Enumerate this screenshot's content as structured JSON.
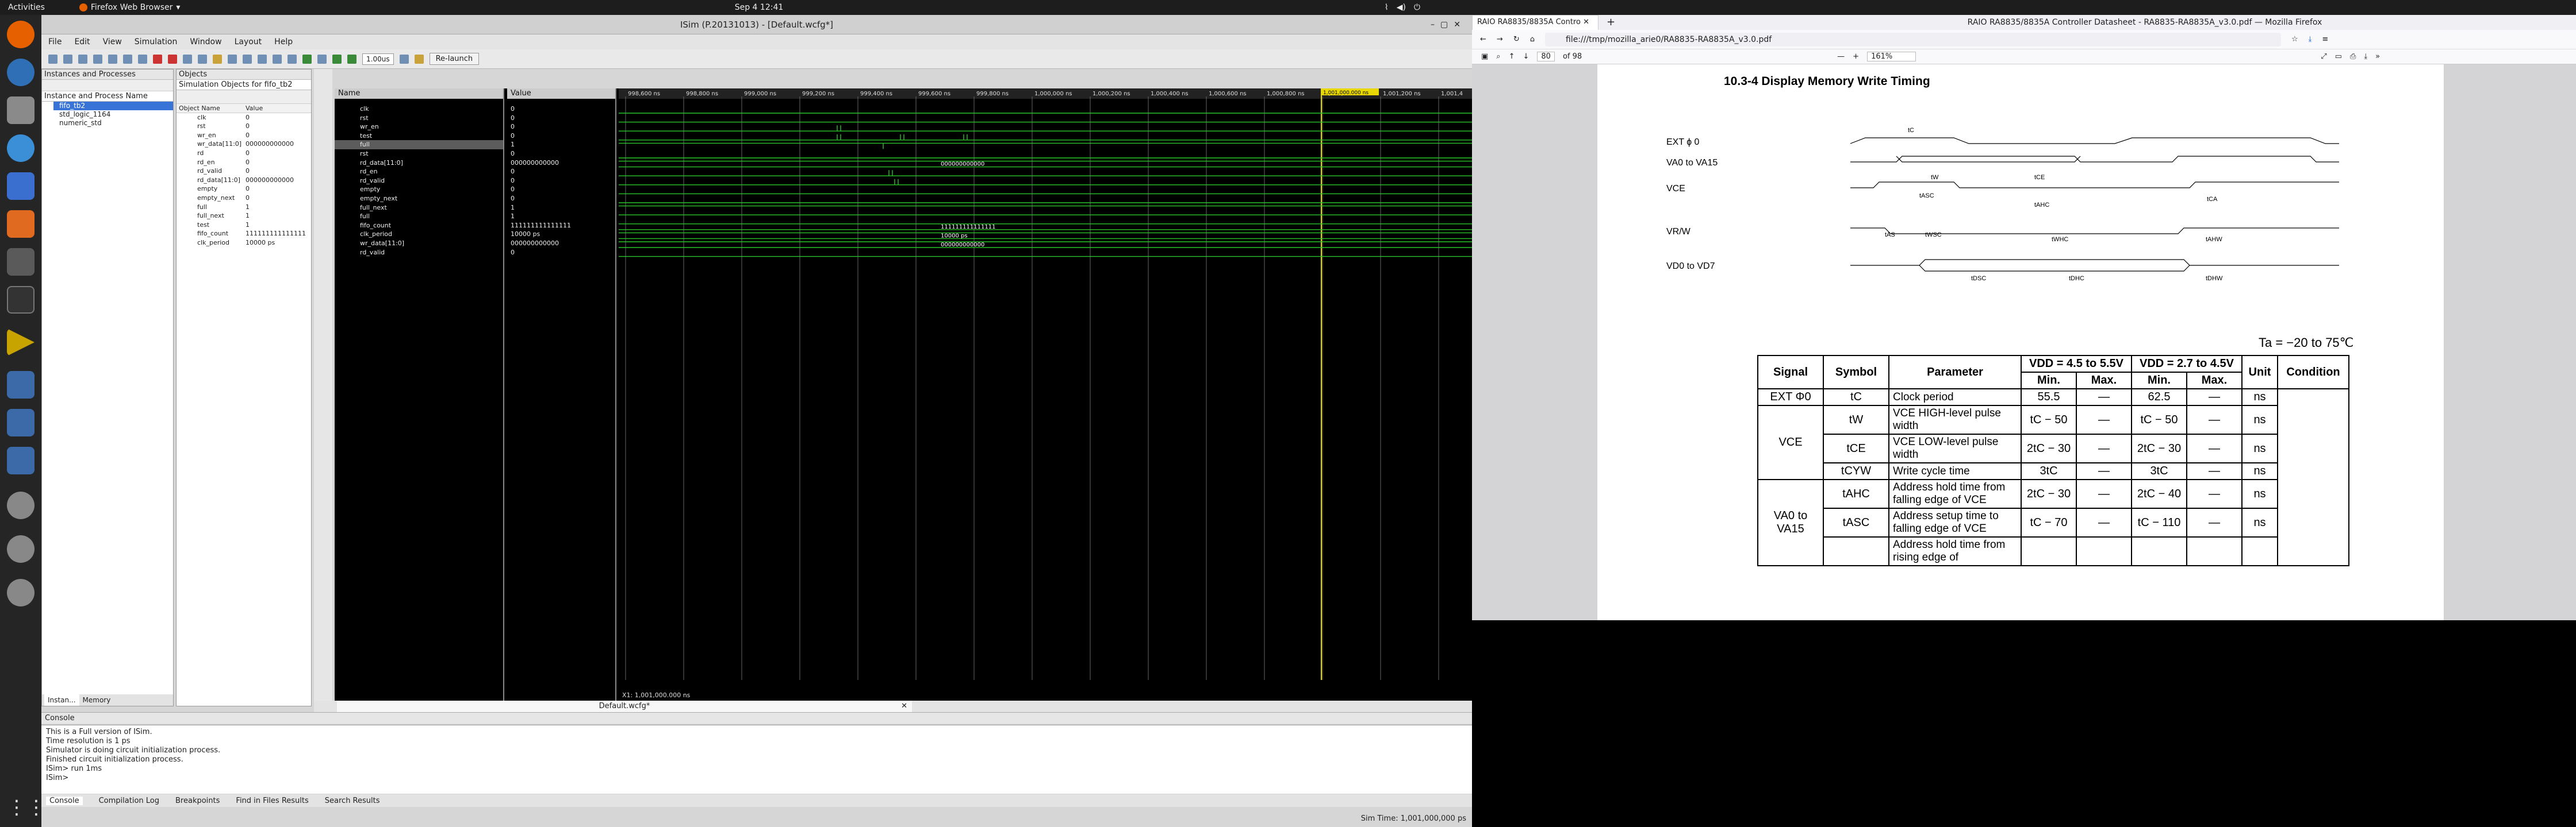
{
  "topbar": {
    "activities": "Activities",
    "app": "Firefox Web Browser",
    "clock": "Sep 4  12:41"
  },
  "isim": {
    "title": "ISim (P.20131013) - [Default.wcfg*]",
    "menus": [
      "File",
      "Edit",
      "View",
      "Simulation",
      "Window",
      "Layout",
      "Help"
    ],
    "time_field": "1.00us",
    "relaunch": "Re-launch",
    "instances_title": "Instances and Processes",
    "instance_col": "Instance and Process Name",
    "instances": [
      "fifo_tb2",
      "std_logic_1164",
      "numeric_std"
    ],
    "objects_title": "Objects",
    "objects_sub": "Simulation Objects for fifo_tb2",
    "objects_cols": {
      "name": "Object Name",
      "value": "Value"
    },
    "objects": [
      {
        "n": "clk",
        "v": "0"
      },
      {
        "n": "rst",
        "v": "0"
      },
      {
        "n": "wr_en",
        "v": "0"
      },
      {
        "n": "wr_data[11:0]",
        "v": "000000000000"
      },
      {
        "n": "rd",
        "v": "0"
      },
      {
        "n": "rd_en",
        "v": "0"
      },
      {
        "n": "rd_valid",
        "v": "0"
      },
      {
        "n": "rd_data[11:0]",
        "v": "000000000000"
      },
      {
        "n": "empty",
        "v": "0"
      },
      {
        "n": "empty_next",
        "v": "0"
      },
      {
        "n": "full",
        "v": "1"
      },
      {
        "n": "full_next",
        "v": "1"
      },
      {
        "n": "test",
        "v": "1"
      },
      {
        "n": "fifo_count",
        "v": "111111111111111"
      },
      {
        "n": "clk_period",
        "v": "10000 ps"
      }
    ],
    "left_tabs": [
      "Instan...",
      "Memory"
    ],
    "wave_cols": {
      "name": "Name",
      "value": "Value"
    },
    "signals": [
      {
        "n": "clk",
        "v": "0"
      },
      {
        "n": "rst",
        "v": "0"
      },
      {
        "n": "wr_en",
        "v": "0"
      },
      {
        "n": "test",
        "v": "0"
      },
      {
        "n": "full",
        "v": "1"
      },
      {
        "n": "rst",
        "v": "0"
      },
      {
        "n": "rd_data[11:0]",
        "v": "000000000000"
      },
      {
        "n": "rd_en",
        "v": "0"
      },
      {
        "n": "rd_valid",
        "v": "0"
      },
      {
        "n": "empty",
        "v": "0"
      },
      {
        "n": "empty_next",
        "v": "0"
      },
      {
        "n": "full_next",
        "v": "1"
      },
      {
        "n": "full",
        "v": "1"
      },
      {
        "n": "fifo_count",
        "v": "111111111111111"
      },
      {
        "n": "clk_period",
        "v": "10000 ps"
      },
      {
        "n": "wr_data[11:0]",
        "v": "000000000000"
      },
      {
        "n": "rd_valid",
        "v": "0"
      }
    ],
    "time_labels": [
      "998,600 ns",
      "998,800 ns",
      "999,000 ns",
      "999,200 ns",
      "999,400 ns",
      "999,600 ns",
      "999,800 ns",
      "1,000,000 ns",
      "1,000,200 ns",
      "1,000,400 ns",
      "1,000,600 ns",
      "1,000,800 ns",
      "1,001,000 ns",
      "1,001,200 ns",
      "1,001,4"
    ],
    "marker_label": "1,001,000.000 ns",
    "cursor_readout": "X1: 1,001,000.000 ns",
    "bus_labels": {
      "rd_data": "000000000000",
      "fifo_count": "111111111111111",
      "clk_period": "10000 ps",
      "wr_data": "000000000000"
    },
    "wave_tab": "Default.wcfg*",
    "console_title": "Console",
    "console_lines": [
      "This is a Full version of ISim.",
      "Time resolution is 1 ps",
      "Simulator is doing circuit initialization process.",
      "Finished circuit initialization process.",
      "ISim> run 1ms",
      "ISim>"
    ],
    "console_tabs": [
      "Console",
      "Compilation Log",
      "Breakpoints",
      "Find in Files Results",
      "Search Results"
    ],
    "sim_time": "Sim Time: 1,001,000,000 ps"
  },
  "firefox": {
    "tab_label": "RAIO RA8835/8835A Contro",
    "window_title": "RAIO RA8835/8835A Controller Datasheet - RA8835-RA8835A_v3.0.pdf — Mozilla Firefox",
    "url": "file:///tmp/mozilla_arie0/RA8835-RA8835A_v3.0.pdf",
    "page_field": "80",
    "page_count": "of 98",
    "zoom": "161%",
    "section_title": "10.3-4 Display Memory Write Timing",
    "timing_signals": [
      "EXT ɸ 0",
      "VA0 to VA15",
      "VCE",
      "VR/W",
      "VD0 to VD7"
    ],
    "timing_labels": [
      "tC",
      "tW",
      "tCE",
      "tASC",
      "tAHC",
      "tCA",
      "tAS",
      "tWSC",
      "tWHC",
      "tAHW",
      "tDSC",
      "tDHC",
      "tDHW"
    ],
    "condition_note": "Ta = −20 to 75℃",
    "table_header": {
      "signal": "Signal",
      "symbol": "Symbol",
      "parameter": "Parameter",
      "vdd1": "VDD = 4.5 to 5.5V",
      "vdd2": "VDD = 2.7 to 4.5V",
      "min": "Min.",
      "max": "Max.",
      "unit": "Unit",
      "condition": "Condition"
    },
    "table_rows": [
      {
        "signal": "EXT Φ0",
        "symbol": "tC",
        "param": "Clock period",
        "min1": "55.5",
        "max1": "—",
        "min2": "62.5",
        "max2": "—",
        "unit": "ns"
      },
      {
        "signal": "VCE",
        "symbol": "tW",
        "param": "VCE  HIGH-level pulse width",
        "min1": "tC − 50",
        "max1": "—",
        "min2": "tC − 50",
        "max2": "—",
        "unit": "ns"
      },
      {
        "signal": "",
        "symbol": "tCE",
        "param": "VCE  LOW-level pulse width",
        "min1": "2tC − 30",
        "max1": "—",
        "min2": "2tC − 30",
        "max2": "—",
        "unit": "ns"
      },
      {
        "signal": "",
        "symbol": "tCYW",
        "param": "Write cycle time",
        "min1": "3tC",
        "max1": "—",
        "min2": "3tC",
        "max2": "—",
        "unit": "ns"
      },
      {
        "signal": "VA0 to VA15",
        "symbol": "tAHC",
        "param": "Address hold time from falling edge of VCE",
        "min1": "2tC − 30",
        "max1": "—",
        "min2": "2tC − 40",
        "max2": "—",
        "unit": "ns"
      },
      {
        "signal": "",
        "symbol": "tASC",
        "param": "Address setup time to falling edge of  VCE",
        "min1": "tC − 70",
        "max1": "—",
        "min2": "tC − 110",
        "max2": "—",
        "unit": "ns"
      },
      {
        "signal": "",
        "symbol": "",
        "param": "Address hold time from rising edge of",
        "min1": "",
        "max1": "",
        "min2": "",
        "max2": "",
        "unit": ""
      }
    ]
  }
}
